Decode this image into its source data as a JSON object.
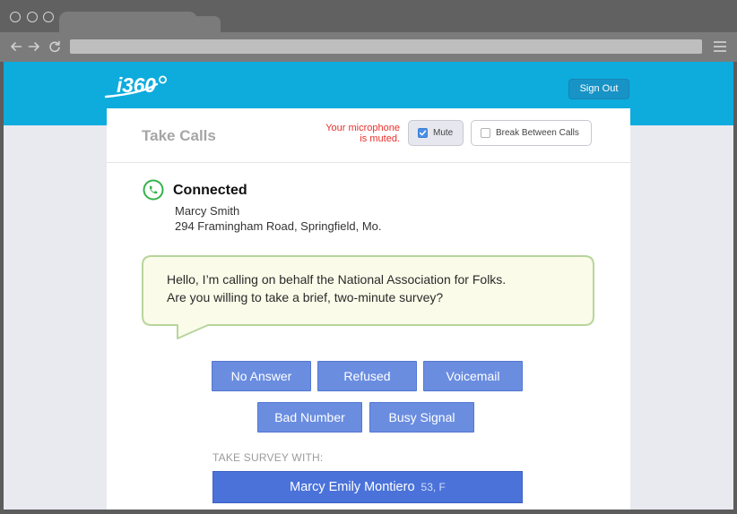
{
  "browser": {
    "window_controls": [
      "window-dot-icon",
      "window-dot-icon",
      "window-dot-icon"
    ],
    "nav_icons": {
      "back": "back-arrow-icon",
      "forward": "forward-arrow-icon",
      "reload": "reload-icon",
      "menu": "hamburger-menu-icon"
    }
  },
  "header": {
    "logo_text": "i360",
    "sign_out_label": "Sign Out"
  },
  "panel": {
    "title": "Take Calls",
    "mic_status": [
      "Your microphone",
      "is muted."
    ],
    "mute": {
      "label": "Mute",
      "checked": true
    },
    "break_between_calls": {
      "label": "Break Between Calls",
      "checked": false
    }
  },
  "call": {
    "status_icon": "phone-icon",
    "status": "Connected",
    "contact_name": "Marcy Smith",
    "contact_address": "294 Framingham Road, Springfield, Mo."
  },
  "script": {
    "lines": [
      "Hello, I’m calling on behalf the National Association for Folks.",
      "Are you willing to take a brief, two-minute survey?"
    ]
  },
  "dispositions": {
    "row1": [
      "No Answer",
      "Refused",
      "Voicemail"
    ],
    "row2": [
      "Bad Number",
      "Busy Signal"
    ]
  },
  "survey": {
    "heading": "TAKE SURVEY WITH:",
    "respondent_name": "Marcy Emily Montiero",
    "respondent_details": "53, F"
  },
  "colors": {
    "header_blue": "#0eabdd",
    "warning_red": "#e8302c",
    "checkbox_blue": "#4b8fe6",
    "connected_green": "#35b34a",
    "bubble_bg": "#fbfbe9",
    "bubble_border": "#b7d59c",
    "disposition_button": "#6a8de0",
    "survey_button": "#4a72d9"
  }
}
